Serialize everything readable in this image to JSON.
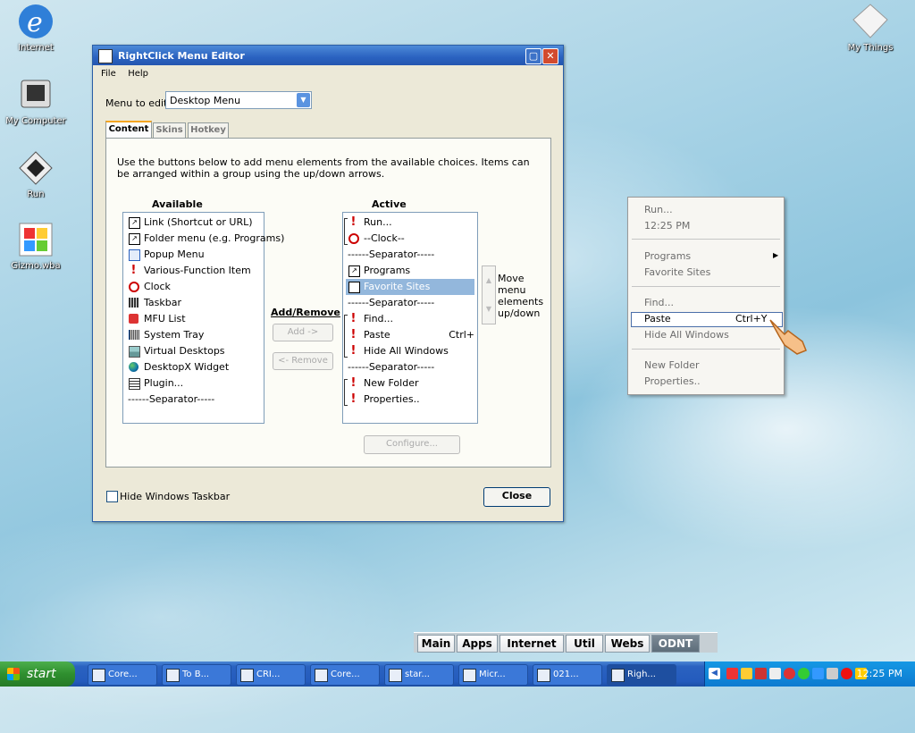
{
  "desktop": {
    "icons": [
      {
        "label": "Internet"
      },
      {
        "label": "My Computer"
      },
      {
        "label": "Run"
      },
      {
        "label": "Gizmo.wba"
      },
      {
        "label": "My Things"
      }
    ]
  },
  "window": {
    "title": "RightClick Menu Editor",
    "menu": [
      "File",
      "Help"
    ],
    "menu_to_edit_label": "Menu to edit:",
    "menu_to_edit_value": "Desktop Menu",
    "tabs": [
      "Content",
      "Skins",
      "Hotkey"
    ],
    "description": "Use the buttons below to add menu elements from the available choices. Items can be arranged within a group using the up/down arrows.",
    "available_header": "Available",
    "active_header": "Active",
    "available_items": [
      {
        "label": "Link (Shortcut or URL)",
        "icon": "link-icon"
      },
      {
        "label": "Folder menu (e.g. Programs)",
        "icon": "folder-menu-icon"
      },
      {
        "label": "Popup Menu",
        "icon": "popup-menu-icon"
      },
      {
        "label": "Various-Function Item",
        "icon": "exclamation-icon"
      },
      {
        "label": "Clock",
        "icon": "clock-icon"
      },
      {
        "label": "Taskbar",
        "icon": "taskbar-icon"
      },
      {
        "label": "MFU List",
        "icon": "mfu-folder-icon"
      },
      {
        "label": "System Tray",
        "icon": "system-tray-icon"
      },
      {
        "label": "Virtual Desktops",
        "icon": "virtual-desktops-icon"
      },
      {
        "label": "DesktopX Widget",
        "icon": "globe-icon"
      },
      {
        "label": "Plugin...",
        "icon": "plugin-icon"
      },
      {
        "label": "------Separator-----",
        "icon": ""
      }
    ],
    "active_items": [
      {
        "label": "Run...",
        "icon": "exclamation-icon",
        "shortcut": ""
      },
      {
        "label": "--Clock--",
        "icon": "clock-icon",
        "shortcut": ""
      },
      {
        "label": "------Separator-----",
        "icon": "",
        "shortcut": ""
      },
      {
        "label": "Programs",
        "icon": "link-icon",
        "shortcut": ""
      },
      {
        "label": "Favorite Sites",
        "icon": "link-icon",
        "shortcut": "",
        "selected": true
      },
      {
        "label": "------Separator-----",
        "icon": "",
        "shortcut": ""
      },
      {
        "label": "Find...",
        "icon": "exclamation-icon",
        "shortcut": ""
      },
      {
        "label": "Paste",
        "icon": "exclamation-icon",
        "shortcut": "Ctrl+"
      },
      {
        "label": "Hide All Windows",
        "icon": "exclamation-icon",
        "shortcut": ""
      },
      {
        "label": "------Separator-----",
        "icon": "",
        "shortcut": ""
      },
      {
        "label": "New Folder",
        "icon": "exclamation-icon",
        "shortcut": ""
      },
      {
        "label": "Properties..",
        "icon": "exclamation-icon",
        "shortcut": ""
      }
    ],
    "add_remove_label": "Add/Remove",
    "add_button": "Add ->",
    "remove_button": "<- Remove",
    "move_label": "Move menu elements up/down",
    "configure_button": "Configure...",
    "hide_taskbar_label": "Hide Windows Taskbar",
    "close_button": "Close"
  },
  "context_menu": {
    "items": [
      {
        "label": "Run...",
        "shortcut": ""
      },
      {
        "label": "12:25 PM",
        "shortcut": ""
      },
      {
        "label": "Programs",
        "shortcut": "",
        "submenu": true
      },
      {
        "label": "Favorite Sites",
        "shortcut": ""
      },
      {
        "label": "Find...",
        "shortcut": ""
      },
      {
        "label": "Paste",
        "shortcut": "Ctrl+Y",
        "highlight": true
      },
      {
        "label": "Hide All Windows",
        "shortcut": ""
      },
      {
        "label": "New Folder",
        "shortcut": ""
      },
      {
        "label": "Properties..",
        "shortcut": ""
      }
    ]
  },
  "dock_tabs": [
    "Main",
    "Apps",
    "Internet",
    "Util",
    "Webs",
    "ODNT"
  ],
  "taskbar": {
    "start_label": "start",
    "tasks": [
      "Core...",
      "To B...",
      "CRI...",
      "Core...",
      "star...",
      "Micr...",
      "021...",
      "Righ..."
    ],
    "clock": "12:25 PM"
  }
}
